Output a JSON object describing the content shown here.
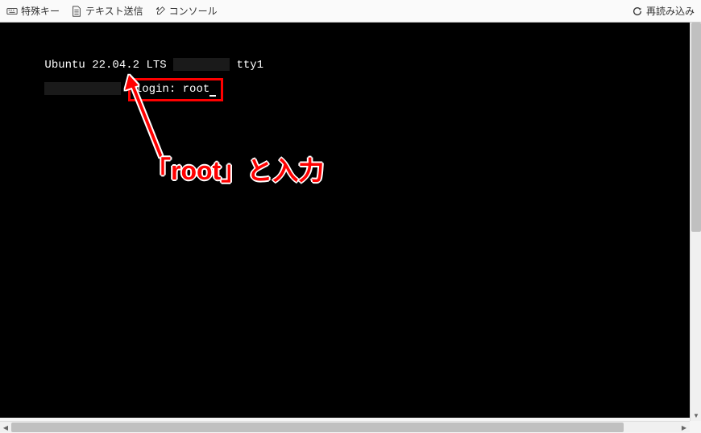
{
  "toolbar": {
    "special_keys_label": "特殊キー",
    "text_send_label": "テキスト送信",
    "console_label": "コンソール",
    "reload_label": "再読み込み"
  },
  "terminal": {
    "line1_prefix": "Ubuntu 22.04.2 LTS ",
    "line1_suffix": " tty1",
    "login_prompt": "login: root",
    "cursor": "_"
  },
  "annotation": {
    "text": "「root」と入力"
  }
}
